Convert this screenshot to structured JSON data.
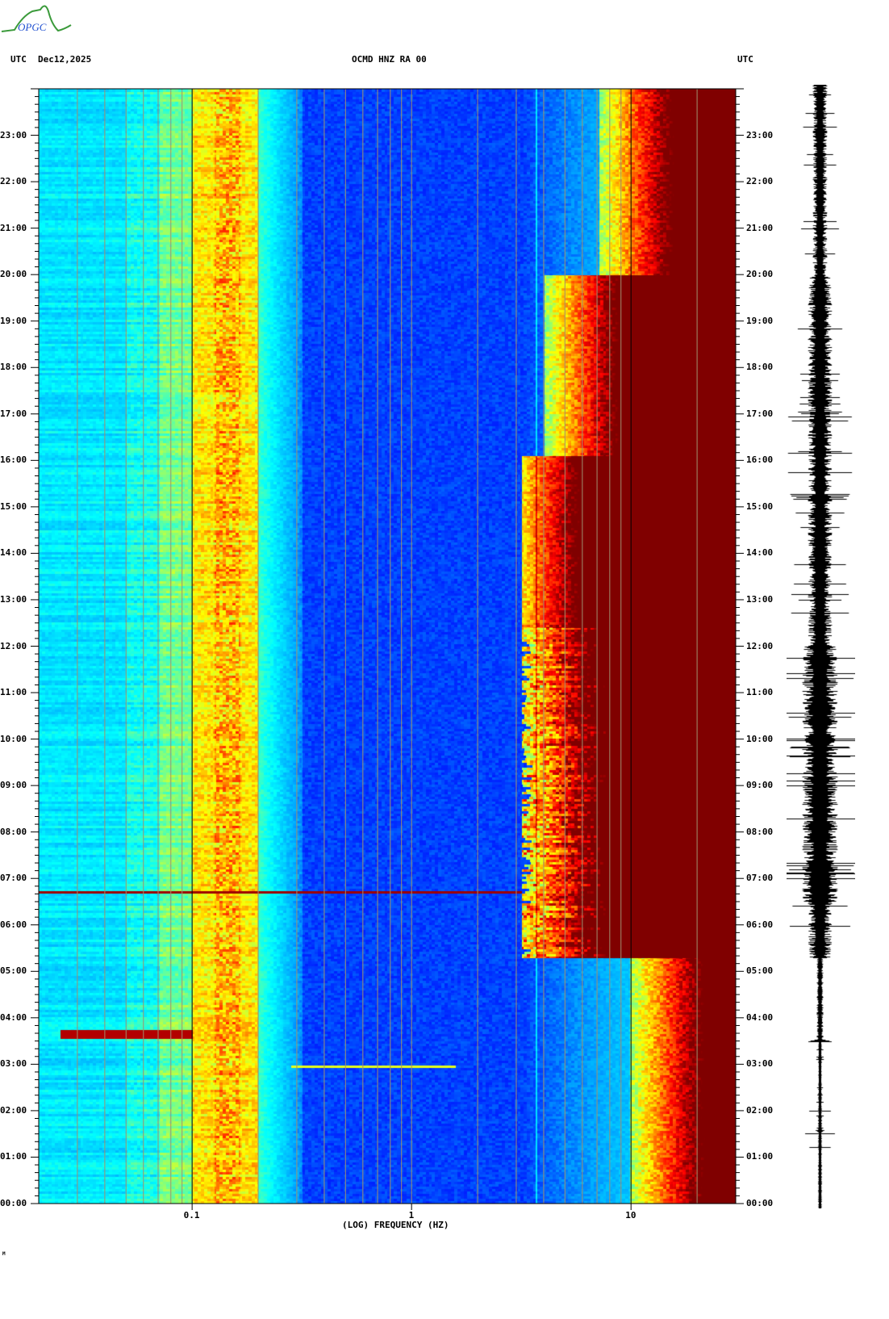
{
  "header": {
    "logo_text": "OPGC",
    "left_label": "UTC",
    "date": "Dec12,2025",
    "station": "OCMD HNZ RA 00",
    "right_label": "UTC"
  },
  "footer_mark": "M",
  "chart_data": {
    "type": "heatmap",
    "title": "OCMD HNZ RA 00",
    "xlabel": "(LOG) FREQUENCY (HZ)",
    "ylabel": "UTC",
    "xscale": "log",
    "xlim": [
      0.02,
      30
    ],
    "ylim_hours": [
      0,
      24
    ],
    "x_ticks": [
      {
        "value": 0.1,
        "label": "0.1"
      },
      {
        "value": 1,
        "label": "1"
      },
      {
        "value": 10,
        "label": "10"
      }
    ],
    "y_ticks": [
      "00:00",
      "01:00",
      "02:00",
      "03:00",
      "04:00",
      "05:00",
      "06:00",
      "07:00",
      "08:00",
      "09:00",
      "10:00",
      "11:00",
      "12:00",
      "13:00",
      "14:00",
      "15:00",
      "16:00",
      "17:00",
      "18:00",
      "19:00",
      "20:00",
      "21:00",
      "22:00",
      "23:00"
    ],
    "colormap": [
      "#00008c",
      "#0000ff",
      "#00a0ff",
      "#00ffff",
      "#80ff80",
      "#ffff00",
      "#ff8000",
      "#ff0000",
      "#800000"
    ],
    "features": [
      {
        "name": "microseism band",
        "freq_hz": [
          0.1,
          0.2
        ],
        "hours": [
          0,
          24
        ]
      },
      {
        "name": "broadband event",
        "freq_hz": [
          0.02,
          3
        ],
        "hours": [
          6.7,
          6.72
        ]
      },
      {
        "name": "low-frequency event",
        "freq_hz": [
          0.025,
          0.1
        ],
        "hours": [
          3.55,
          3.75
        ]
      },
      {
        "name": "daytime cultural noise",
        "freq_hz": [
          6,
          30
        ],
        "hours": [
          5.3,
          24
        ]
      }
    ]
  }
}
